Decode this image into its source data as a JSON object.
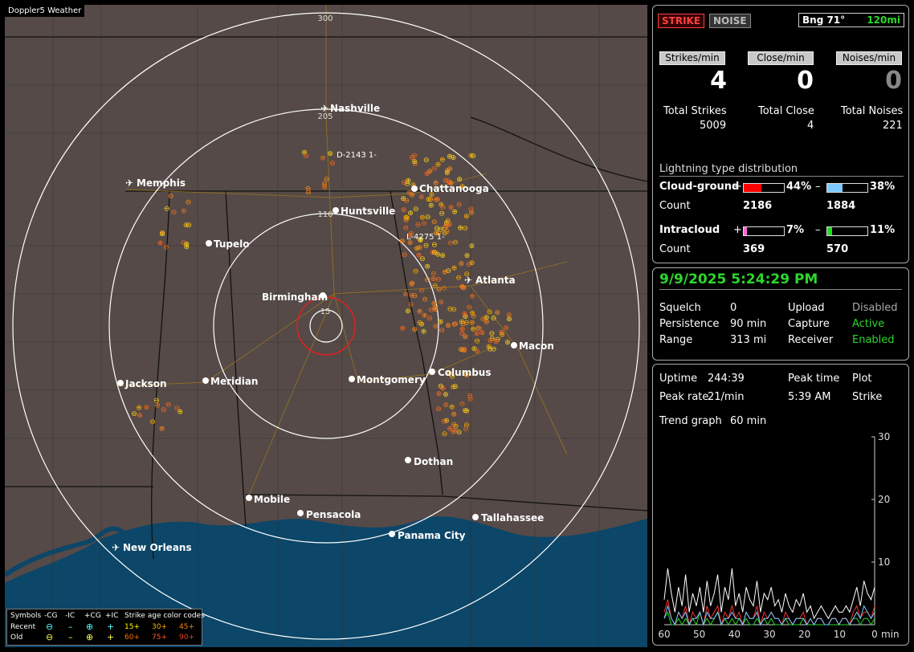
{
  "map": {
    "title": "Doppler5 Weather",
    "ring_labels": [
      "300",
      "205",
      "110",
      "15"
    ],
    "cities": [
      "Nashville",
      "Memphis",
      "Chattanooga",
      "Huntsville",
      "Tupelo",
      "Birmingham",
      "Atlanta",
      "Macon",
      "Jackson",
      "Meridian",
      "Montgomery",
      "Columbus",
      "Dothan",
      "Mobile",
      "Pensacola",
      "Tallahassee",
      "Panama City",
      "New Orleans"
    ],
    "track_labels": [
      "D-2143 1-",
      "L-4275 1-"
    ]
  },
  "legend": {
    "symbols_label": "Symbols",
    "cols": [
      "-CG",
      "-IC",
      "+CG",
      "+IC"
    ],
    "age_label": "Strike age color codes",
    "recent_label": "Recent",
    "old_label": "Old",
    "recent_ages": [
      "15+",
      "30+",
      "45+"
    ],
    "old_ages": [
      "60+",
      "75+",
      "90+"
    ]
  },
  "top": {
    "strike_btn": "STRIKE",
    "noise_btn": "NOISE",
    "bearing": "Bng 71°",
    "range": "120mi"
  },
  "rates": {
    "strikes_label": "Strikes/min",
    "close_label": "Close/min",
    "noises_label": "Noises/min",
    "strikes": "4",
    "close": "0",
    "noises": "0"
  },
  "totals": {
    "strikes_label": "Total Strikes",
    "close_label": "Total Close",
    "noises_label": "Total Noises",
    "strikes": "5009",
    "close": "4",
    "noises": "221"
  },
  "distribution": {
    "title": "Lightning type distribution",
    "cg_label": "Cloud-ground",
    "ic_label": "Intracloud",
    "count_label": "Count",
    "plus": "+",
    "minus": "–",
    "cg_pos_pct": "44%",
    "cg_neg_pct": "38%",
    "cg_pos_count": "2186",
    "cg_neg_count": "1884",
    "ic_pos_pct": "7%",
    "ic_neg_pct": "11%",
    "ic_pos_count": "369",
    "ic_neg_count": "570",
    "cg_pos_frac": 0.44,
    "cg_neg_frac": 0.38,
    "ic_pos_frac": 0.07,
    "ic_neg_frac": 0.11,
    "colors": {
      "cg_pos": "#ff0000",
      "cg_neg": "#7ec8ff",
      "ic_pos": "#ff6ad5",
      "ic_neg": "#22dd22"
    }
  },
  "status": {
    "datetime": "9/9/2025 5:24:29 PM",
    "squelch_label": "Squelch",
    "squelch": "0",
    "upload_label": "Upload",
    "upload": "Disabled",
    "persistence_label": "Persistence",
    "persistence": "90 min",
    "capture_label": "Capture",
    "capture": "Active",
    "range_label": "Range",
    "range": "313 mi",
    "receiver_label": "Receiver",
    "receiver": "Enabled"
  },
  "stats": {
    "uptime_label": "Uptime",
    "uptime": "244:39",
    "peak_time_label": "Peak time",
    "peak_time": "5:39 AM",
    "plot_label": "Plot",
    "plot": "Strike",
    "peak_rate_label": "Peak rate",
    "peak_rate": "21/min",
    "trend_label": "Trend graph",
    "trend": "60 min"
  },
  "chart_data": {
    "type": "line",
    "xlabel": "min",
    "xlim": [
      60,
      0
    ],
    "ylim": [
      0,
      30
    ],
    "xticks": [
      "60",
      "50",
      "40",
      "30",
      "20",
      "10",
      "0"
    ],
    "yticks": [
      "30",
      "20",
      "10"
    ],
    "series": [
      {
        "color": "#ffffff",
        "values": [
          4,
          9,
          5,
          2,
          6,
          3,
          8,
          2,
          5,
          3,
          6,
          2,
          7,
          3,
          5,
          8,
          2,
          6,
          4,
          9,
          3,
          5,
          2,
          6,
          4,
          3,
          7,
          2,
          5,
          4,
          6,
          3,
          4,
          2,
          5,
          3,
          2,
          4,
          3,
          5,
          2,
          3,
          1,
          2,
          3,
          2,
          1,
          2,
          3,
          2,
          2,
          3,
          2,
          4,
          6,
          3,
          7,
          5,
          4,
          6
        ]
      },
      {
        "color": "#ff3030",
        "values": [
          2,
          4,
          1,
          0,
          2,
          1,
          3,
          0,
          2,
          1,
          2,
          0,
          3,
          1,
          2,
          3,
          0,
          2,
          1,
          3,
          1,
          2,
          0,
          2,
          1,
          1,
          3,
          0,
          2,
          1,
          2,
          1,
          1,
          0,
          2,
          1,
          0,
          1,
          1,
          2,
          0,
          1,
          0,
          1,
          1,
          0,
          0,
          1,
          1,
          0,
          1,
          1,
          0,
          2,
          3,
          1,
          2,
          2,
          1,
          3
        ]
      },
      {
        "color": "#22dd22",
        "values": [
          1,
          2,
          0,
          0,
          1,
          0,
          1,
          0,
          1,
          0,
          2,
          0,
          1,
          0,
          1,
          2,
          0,
          1,
          0,
          1,
          0,
          1,
          0,
          1,
          0,
          0,
          1,
          0,
          1,
          0,
          1,
          0,
          0,
          0,
          1,
          0,
          0,
          0,
          0,
          1,
          0,
          0,
          0,
          0,
          0,
          0,
          0,
          0,
          0,
          0,
          0,
          0,
          0,
          1,
          1,
          0,
          1,
          1,
          0,
          1
        ]
      },
      {
        "color": "#7ec8ff",
        "values": [
          1,
          3,
          1,
          0,
          2,
          1,
          2,
          0,
          1,
          1,
          2,
          0,
          2,
          1,
          1,
          2,
          0,
          1,
          1,
          2,
          1,
          1,
          0,
          2,
          1,
          1,
          2,
          0,
          1,
          1,
          2,
          1,
          1,
          0,
          1,
          1,
          0,
          1,
          1,
          1,
          0,
          1,
          0,
          1,
          1,
          0,
          0,
          1,
          1,
          0,
          1,
          1,
          0,
          1,
          2,
          1,
          3,
          2,
          1,
          2
        ]
      }
    ]
  }
}
